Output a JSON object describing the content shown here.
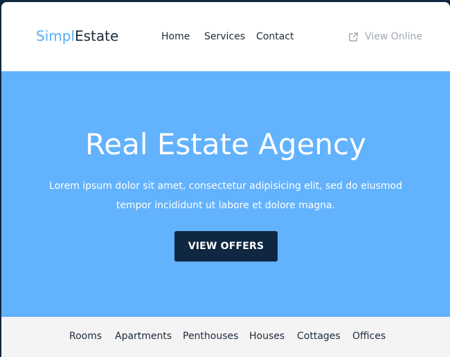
{
  "brand": {
    "logo_part1": "Simpl",
    "logo_part2": "Estate",
    "accent_color": "#5aaef6"
  },
  "nav": {
    "items": [
      "Home",
      "Services",
      "Contact"
    ]
  },
  "view_online": {
    "label": "View Online",
    "icon": "external-link-icon"
  },
  "hero": {
    "title": "Real Estate Agency",
    "text": "Lorem ipsum dolor sit amet, consectetur adipisicing elit, sed do eiusmod tempor incididunt ut labore et dolore magna.",
    "button_label": "VIEW OFFERS",
    "background_color": "#62b2fd",
    "button_color": "#0f2741"
  },
  "categories": {
    "items": [
      "Rooms",
      "Apartments",
      "Penthouses",
      "Houses",
      "Cottages",
      "Offices"
    ]
  }
}
